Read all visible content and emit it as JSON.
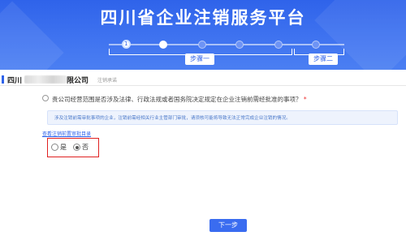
{
  "header": {
    "title": "四川省企业注销服务平台",
    "steps": [
      {
        "label": "步骤一"
      },
      {
        "label": "步骤二"
      }
    ],
    "current_step_mark": "1"
  },
  "company": {
    "prefix": "四川",
    "suffix": "限公司",
    "subtitle": "注销承诺"
  },
  "question": {
    "text": "贵公司经营范围是否涉及法律、行政法规或者国务院决定规定在企业注销前需经批准的事项？",
    "required_mark": "*"
  },
  "notice": {
    "text": "涉及注销前需审批事项的企业，注销前需经相关行业主管部门审批，请须核可能将导致无法正常完成企业注销的情况。"
  },
  "catalog_link": "查看注销前置审批目录",
  "options": [
    {
      "label": "是",
      "checked": false
    },
    {
      "label": "否",
      "checked": true
    }
  ],
  "next_button": "下一步",
  "colors": {
    "primary": "#2f63ea",
    "highlight": "#e02020"
  }
}
